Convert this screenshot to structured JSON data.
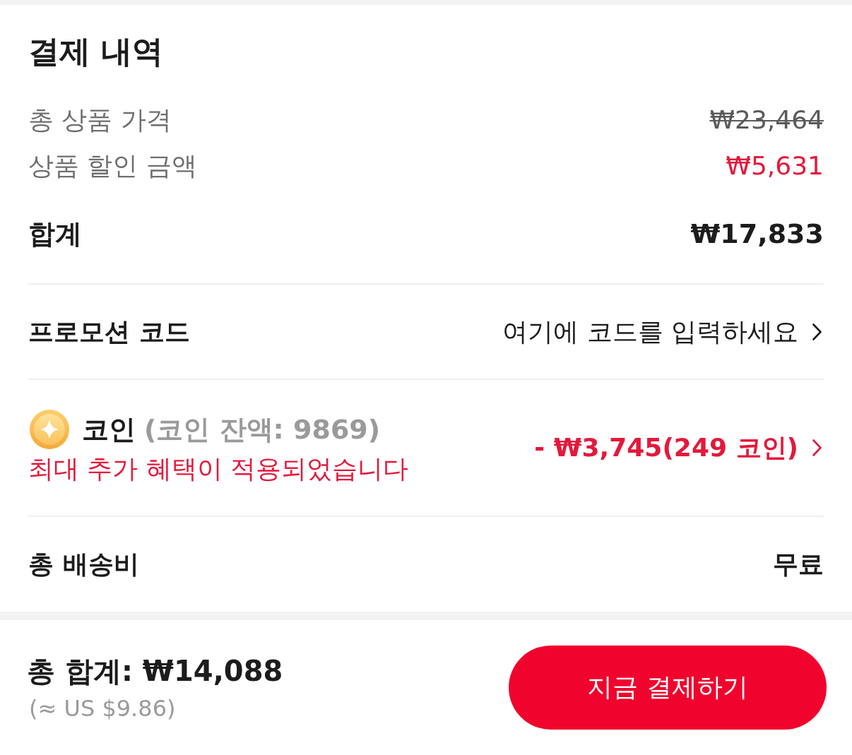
{
  "section": {
    "title": "결제 내역"
  },
  "price_rows": [
    {
      "kind": "original",
      "label": "총 상품 가격",
      "value": "₩23,464"
    },
    {
      "kind": "discount",
      "label": "상품 할인 금액",
      "value": "₩5,631"
    },
    {
      "kind": "subtotal",
      "label": "합계",
      "value": "₩17,833"
    }
  ],
  "promo": {
    "label": "프로모션 코드",
    "prompt": "여기에 코드를 입력하세요"
  },
  "coins": {
    "label": "코인",
    "balance": "(코인 잔액: 9869)",
    "note": "최대 추가 혜택이 적용되었습니다",
    "value": "- ₩3,745(249 코인)"
  },
  "shipping": {
    "label": "총 배송비",
    "value": "무료"
  },
  "footer": {
    "total": "총 합계: ₩14,088",
    "converted": "(≈ US $9.86)",
    "button": "지금 결제하기"
  }
}
